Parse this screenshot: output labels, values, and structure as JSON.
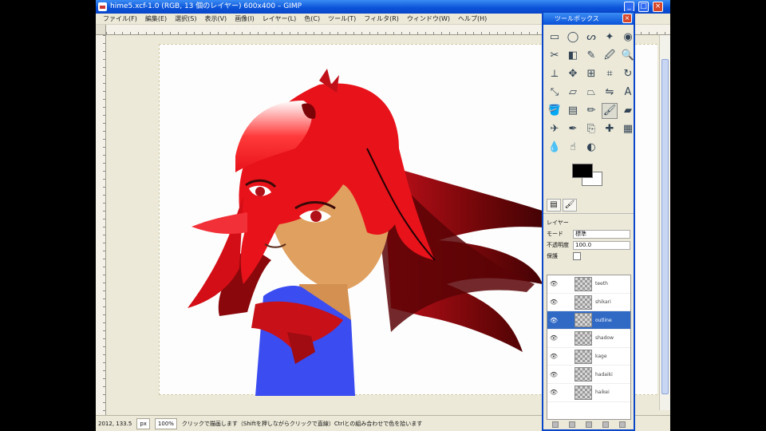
{
  "image_window": {
    "title": "hime5.xcf-1.0 (RGB, 13 個のレイヤー) 600x400 – GIMP",
    "menus": [
      "ファイル(F)",
      "編集(E)",
      "選択(S)",
      "表示(V)",
      "画像(I)",
      "レイヤー(L)",
      "色(C)",
      "ツール(T)",
      "フィルタ(R)",
      "ウィンドウ(W)",
      "ヘルプ(H)"
    ],
    "status": {
      "coords": "2012, 133.5",
      "unit": "px",
      "zoom": "100%",
      "message": "クリックで描画します（Shiftを押しながらクリックで直線）Ctrlとの組み合わせで色を拾います"
    }
  },
  "toolbox": {
    "title": "ツールボックス",
    "tools": [
      {
        "name": "rect-select-icon",
        "glyph": "▭"
      },
      {
        "name": "ellipse-select-icon",
        "glyph": "◯"
      },
      {
        "name": "lasso-icon",
        "glyph": "ᔕ"
      },
      {
        "name": "wand-icon",
        "glyph": "✦"
      },
      {
        "name": "color-select-icon",
        "glyph": "◉"
      },
      {
        "name": "scissors-icon",
        "glyph": "✂"
      },
      {
        "name": "foreground-select-icon",
        "glyph": "◧"
      },
      {
        "name": "paths-icon",
        "glyph": "✎"
      },
      {
        "name": "color-picker-icon",
        "glyph": "🖉"
      },
      {
        "name": "zoom-icon",
        "glyph": "🔍"
      },
      {
        "name": "measure-icon",
        "glyph": "⟂"
      },
      {
        "name": "move-icon",
        "glyph": "✥"
      },
      {
        "name": "align-icon",
        "glyph": "⊞"
      },
      {
        "name": "crop-icon",
        "glyph": "⌗"
      },
      {
        "name": "rotate-icon",
        "glyph": "↻"
      },
      {
        "name": "scale-icon",
        "glyph": "⤡"
      },
      {
        "name": "shear-icon",
        "glyph": "▱"
      },
      {
        "name": "perspective-icon",
        "glyph": "⏢"
      },
      {
        "name": "flip-icon",
        "glyph": "⇋"
      },
      {
        "name": "text-icon",
        "glyph": "A"
      },
      {
        "name": "bucket-fill-icon",
        "glyph": "🪣"
      },
      {
        "name": "blend-icon",
        "glyph": "▤"
      },
      {
        "name": "pencil-icon",
        "glyph": "✏"
      },
      {
        "name": "paintbrush-icon",
        "glyph": "🖌"
      },
      {
        "name": "eraser-icon",
        "glyph": "▰"
      },
      {
        "name": "airbrush-icon",
        "glyph": "✈"
      },
      {
        "name": "ink-icon",
        "glyph": "✒"
      },
      {
        "name": "clone-icon",
        "glyph": "⎘"
      },
      {
        "name": "heal-icon",
        "glyph": "✚"
      },
      {
        "name": "perspective-clone-icon",
        "glyph": "▦"
      },
      {
        "name": "blur-icon",
        "glyph": "💧"
      },
      {
        "name": "smudge-icon",
        "glyph": "☝"
      },
      {
        "name": "dodge-burn-icon",
        "glyph": "◐"
      }
    ],
    "active_tool": 23
  },
  "layers_dock": {
    "label_layer": "レイヤー",
    "label_mode": "モード",
    "mode_value": "標準",
    "label_opacity": "不透明度",
    "opacity_value": "100.0",
    "label_lock": "保護",
    "layers": [
      {
        "name": "teeth",
        "selected": false
      },
      {
        "name": "shikari",
        "selected": false
      },
      {
        "name": "outline",
        "selected": true
      },
      {
        "name": "shadow",
        "selected": false
      },
      {
        "name": "kage",
        "selected": false
      },
      {
        "name": "hadaiki",
        "selected": false
      },
      {
        "name": "haikei",
        "selected": false
      }
    ]
  },
  "colors": {
    "foreground": "#000000",
    "background": "#ffffff",
    "titlebar": "#0a52d8",
    "hair_red": "#e8121a",
    "scarf_blue": "#3b4cf0"
  }
}
